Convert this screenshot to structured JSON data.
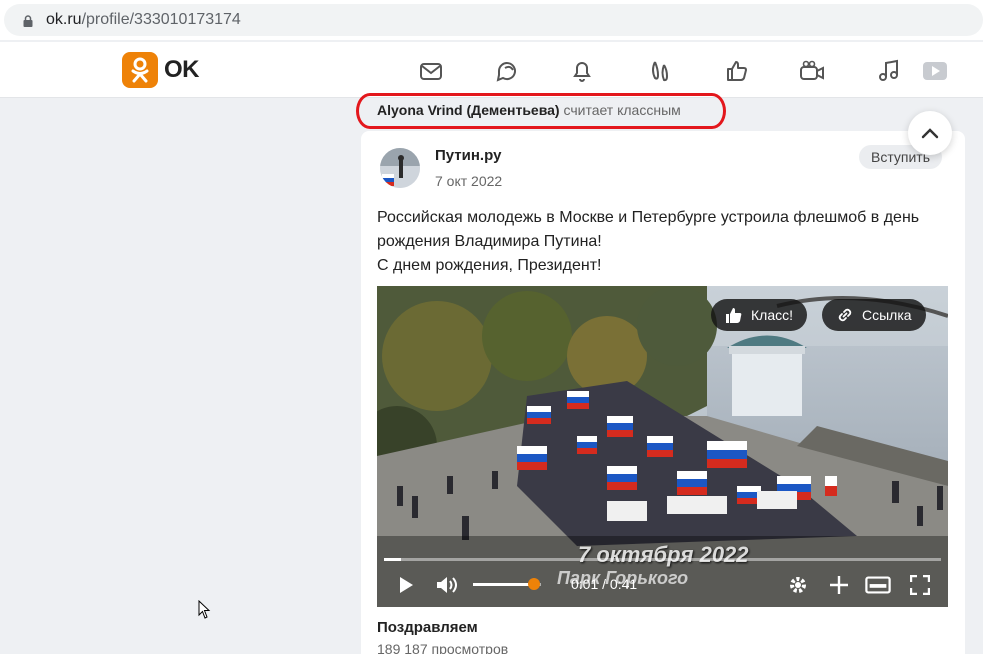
{
  "browser": {
    "url_host": "ok.ru",
    "url_path": "/profile/333010173174"
  },
  "header": {
    "logo_text": "OK",
    "brand_color": "#ee8208",
    "nav_icons": [
      "mail-icon",
      "chat-icon",
      "bell-icon",
      "guests-icon",
      "like-icon",
      "video-camera-icon",
      "music-icon",
      "play-icon"
    ]
  },
  "feed": {
    "liker_name": "Alyona Vrind (Дементьева)",
    "liker_action": "считает классным",
    "highlight_color": "#e3171c",
    "post": {
      "group_name": "Путин.ру",
      "date": "7 окт 2022",
      "join_label": "Вступить",
      "text_lines": [
        "Российская молодежь в Москве и Петербурге устроила флешмоб в день",
        "рождения Владимира Путина!",
        "С днем рождения, Президент!"
      ],
      "video": {
        "like_label": "Класс!",
        "share_label": "Ссылка",
        "overlay_date": "7 октября 2022",
        "overlay_place": "Парк Горького",
        "time": "0:01 / 0:41",
        "progress": 0.03,
        "volume": 0.9,
        "volume_color": "#ee8208"
      },
      "title": "Поздравляем",
      "views": "189 187 просмотров"
    }
  }
}
